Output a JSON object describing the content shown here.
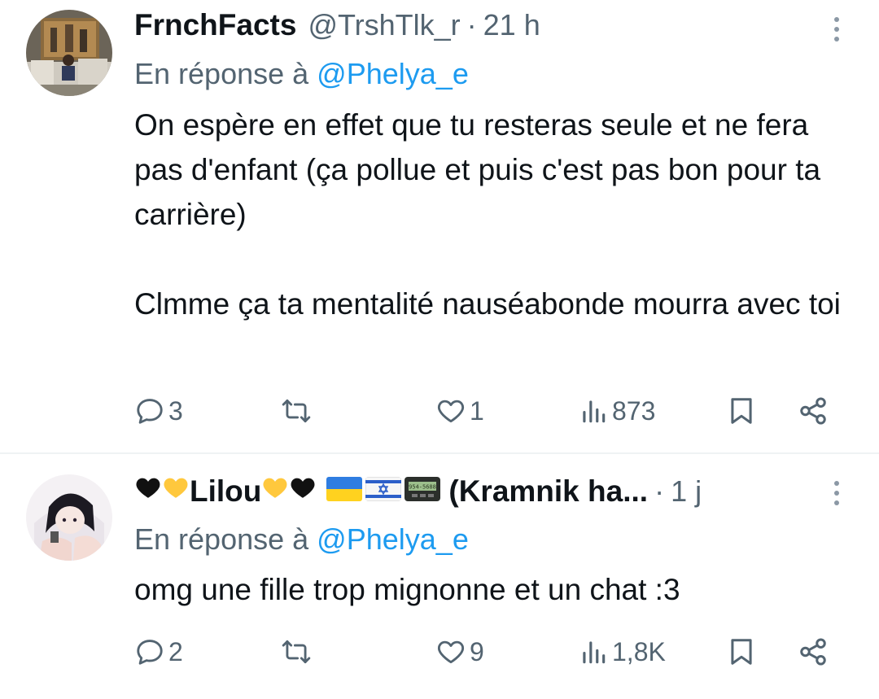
{
  "tweets": [
    {
      "display_name": "FrnchFacts",
      "handle": "@TrshTlk_r",
      "separator": "·",
      "time": "21 h",
      "reply_prefix": "En réponse à",
      "reply_mention": "@Phelya_e",
      "text": "On espère en effet que tu resteras seule et ne fera pas d'enfant (ça pollue et puis c'est pas bon pour ta carrière)\n\nClmme ça ta mentalité nauséabonde mourra avec toi",
      "replies": "3",
      "retweets": "",
      "likes": "1",
      "views": "873"
    },
    {
      "display_name": "Lilou",
      "name_suffix": "(Kramnik ha...",
      "separator": "·",
      "time": "1 j",
      "reply_prefix": "En réponse à",
      "reply_mention": "@Phelya_e",
      "text": "omg une fille trop mignonne et un chat :3",
      "replies": "2",
      "retweets": "",
      "likes": "9",
      "views": "1,8K",
      "pager_text": "954-5688"
    }
  ],
  "colors": {
    "text": "#0f1419",
    "secondary": "#536471",
    "link": "#1d9bf0",
    "divider": "#eff3f4"
  }
}
